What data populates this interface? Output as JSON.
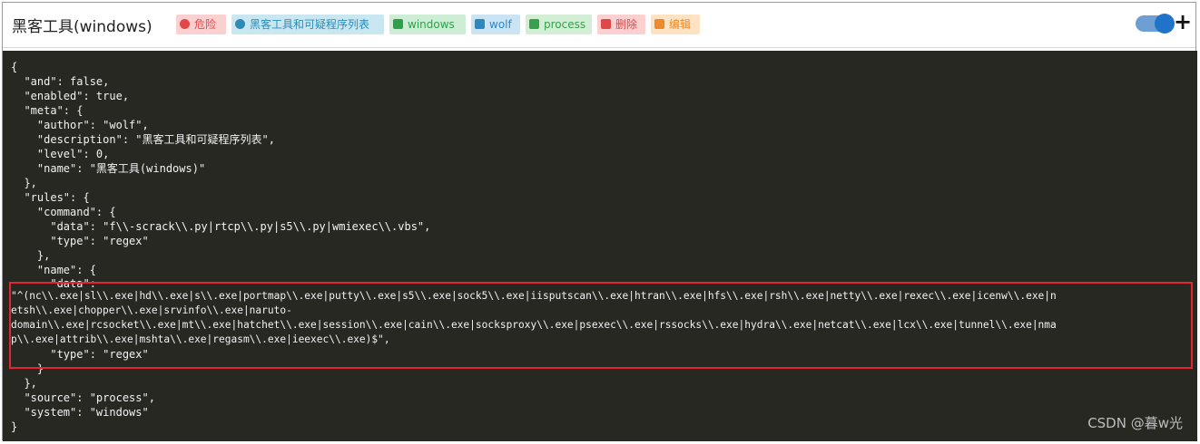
{
  "header": {
    "title": "黑客工具(windows)",
    "tags": [
      {
        "label": "危险",
        "icon": "danger-icon",
        "bg": "#fbd0d0",
        "fg": "#e04848"
      },
      {
        "label": "黑客工具和可疑程序列表",
        "icon": "comment-icon",
        "bg": "#c9e7f1",
        "fg": "#2d8bb5"
      },
      {
        "label": "windows",
        "icon": "monitor-icon",
        "bg": "#cdeed5",
        "fg": "#2fa04a"
      },
      {
        "label": "wolf",
        "icon": "edit-square-icon",
        "bg": "#cbe4f4",
        "fg": "#2d88c0"
      },
      {
        "label": "process",
        "icon": "bookmark-icon",
        "bg": "#d2efd6",
        "fg": "#36a04c"
      },
      {
        "label": "删除",
        "icon": "trash-icon",
        "bg": "#fbd0d0",
        "fg": "#e04848"
      },
      {
        "label": "编辑",
        "icon": "pencil-icon",
        "bg": "#fde3c4",
        "fg": "#ef8a2a"
      }
    ],
    "toggle_state": "on",
    "add_label": "+"
  },
  "code": {
    "lines": [
      "{",
      "  \"and\": false,",
      "  \"enabled\": true,",
      "  \"meta\": {",
      "    \"author\": \"wolf\",",
      "    \"description\": \"黑客工具和可疑程序列表\",",
      "    \"level\": 0,",
      "    \"name\": \"黑客工具(windows)\"",
      "  },",
      "  \"rules\": {",
      "    \"command\": {",
      "      \"data\": \"f\\\\-scrack\\\\.py|rtcp\\\\.py|s5\\\\.py|wmiexec\\\\.vbs\",",
      "      \"type\": \"regex\"",
      "    },",
      "    \"name\": {",
      "      \"data\":",
      "\"^(nc\\\\.exe|sl\\\\.exe|hd\\\\.exe|s\\\\.exe|portmap\\\\.exe|putty\\\\.exe|s5\\\\.exe|sock5\\\\.exe|iisputscan\\\\.exe|htran\\\\.exe|hfs\\\\.exe|rsh\\\\.exe|netty\\\\.exe|rexec\\\\.exe|icenw\\\\.exe|n",
      "etsh\\\\.exe|chopper\\\\.exe|srvinfo\\\\.exe|naruto-",
      "domain\\\\.exe|rcsocket\\\\.exe|mt\\\\.exe|hatchet\\\\.exe|session\\\\.exe|cain\\\\.exe|socksproxy\\\\.exe|psexec\\\\.exe|rssocks\\\\.exe|hydra\\\\.exe|netcat\\\\.exe|lcx\\\\.exe|tunnel\\\\.exe|nma",
      "p\\\\.exe|attrib\\\\.exe|mshta\\\\.exe|regasm\\\\.exe|ieexec\\\\.exe)$\",",
      "      \"type\": \"regex\"",
      "    }",
      "  },",
      "  \"source\": \"process\",",
      "  \"system\": \"windows\"",
      "}"
    ]
  },
  "watermark": "CSDN @暮w光",
  "colors": {
    "code_bg": "#272822",
    "code_fg": "#f2f2f2",
    "highlight_border": "#e3262f",
    "toggle_track": "#6e9fd3",
    "toggle_knob": "#1f73c9"
  }
}
